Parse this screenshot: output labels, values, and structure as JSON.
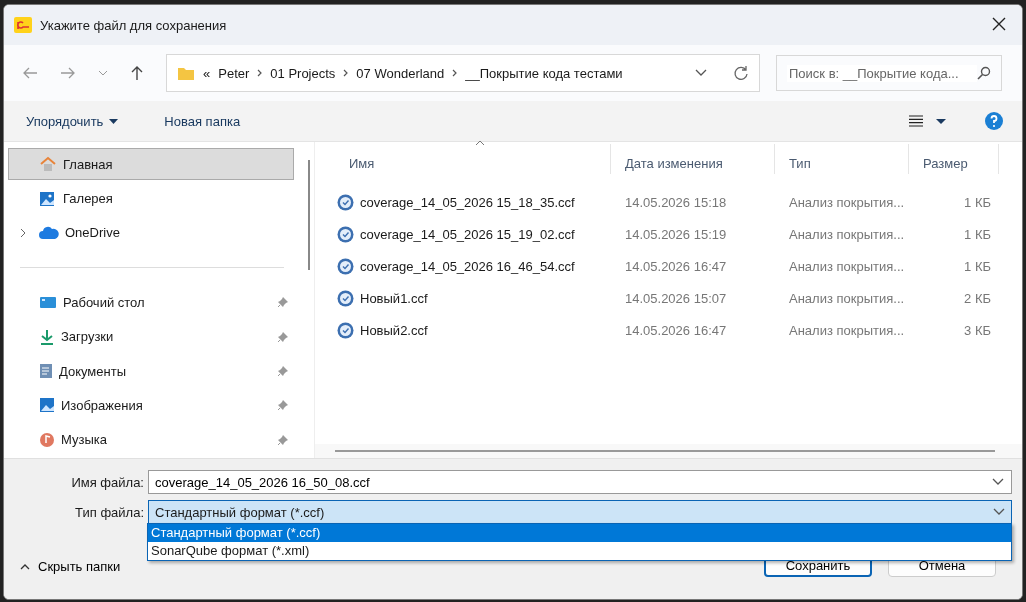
{
  "window": {
    "title": "Укажите файл для сохранения"
  },
  "breadcrumb": [
    "Peter",
    "01 Projects",
    "07 Wonderland",
    "__Покрытие кода тестами"
  ],
  "breadcrumb_overflow": "«",
  "search": {
    "placeholder": "Поиск в: __Покрытие кода..."
  },
  "toolbar": {
    "organize": "Упорядочить",
    "new_folder": "Новая папка"
  },
  "sidebar": {
    "items": [
      {
        "label": "Главная",
        "selected": true,
        "pinned": false,
        "expandable": false
      },
      {
        "label": "Галерея",
        "selected": false,
        "pinned": false,
        "expandable": false
      },
      {
        "label": "OneDrive",
        "selected": false,
        "pinned": false,
        "expandable": true
      },
      {
        "label": "Рабочий стол",
        "selected": false,
        "pinned": true,
        "expandable": false
      },
      {
        "label": "Загрузки",
        "selected": false,
        "pinned": true,
        "expandable": false
      },
      {
        "label": "Документы",
        "selected": false,
        "pinned": true,
        "expandable": false
      },
      {
        "label": "Изображения",
        "selected": false,
        "pinned": true,
        "expandable": false
      },
      {
        "label": "Музыка",
        "selected": false,
        "pinned": true,
        "expandable": false
      }
    ]
  },
  "table": {
    "columns": [
      "Имя",
      "Дата изменения",
      "Тип",
      "Размер"
    ],
    "rows": [
      {
        "name": "coverage_14_05_2026 15_18_35.ccf",
        "date": "14.05.2026 15:18",
        "type": "Анализ покрытия...",
        "size": "1 КБ"
      },
      {
        "name": "coverage_14_05_2026 15_19_02.ccf",
        "date": "14.05.2026 15:19",
        "type": "Анализ покрытия...",
        "size": "1 КБ"
      },
      {
        "name": "coverage_14_05_2026 16_46_54.ccf",
        "date": "14.05.2026 16:47",
        "type": "Анализ покрытия...",
        "size": "1 КБ"
      },
      {
        "name": "Новый1.ccf",
        "date": "14.05.2026 15:07",
        "type": "Анализ покрытия...",
        "size": "2 КБ"
      },
      {
        "name": "Новый2.ccf",
        "date": "14.05.2026 16:47",
        "type": "Анализ покрытия...",
        "size": "3 КБ"
      }
    ]
  },
  "file_name": {
    "label": "Имя файла:",
    "value": "coverage_14_05_2026 16_50_08.ccf"
  },
  "file_type": {
    "label": "Тип файла:",
    "value": "Стандартный формат (*.ccf)",
    "expanded": true,
    "options": [
      {
        "label": "Стандартный формат (*.ccf)",
        "selected": true
      },
      {
        "label": "SonarQube формат (*.xml)",
        "selected": false
      }
    ]
  },
  "hide_folders": "Скрыть папки",
  "buttons": [
    "Сохранить",
    "Отмена"
  ]
}
